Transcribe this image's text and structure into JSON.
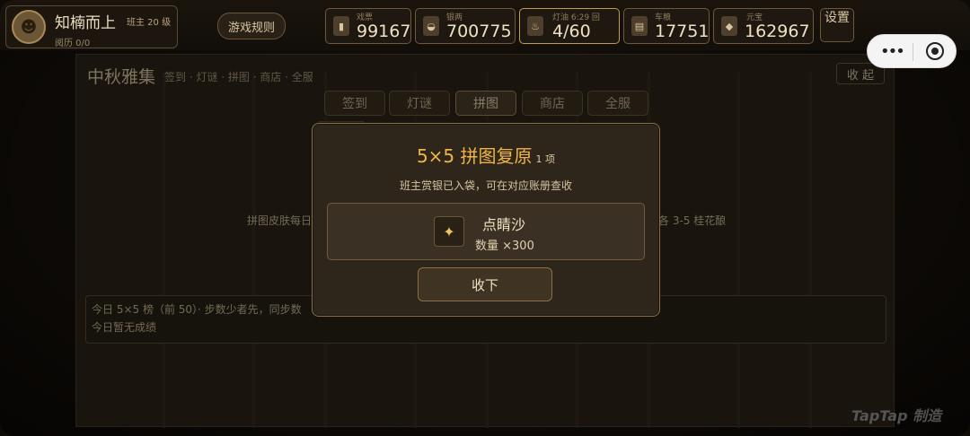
{
  "header": {
    "player_name": "知楠而上",
    "player_level": "班主 20 级",
    "player_sub": "阅历 0/0",
    "rules_label": "游戏规则",
    "settings_label": "设置",
    "resources": [
      {
        "label": "戏票",
        "value": "99167",
        "icon": "ticket-icon"
      },
      {
        "label": "银两",
        "value": "700775",
        "icon": "silver-icon"
      },
      {
        "label": "灯油 6:29 回",
        "value": "4/60",
        "icon": "oil-lamp-icon"
      },
      {
        "label": "车粮",
        "value": "17751",
        "icon": "grain-icon"
      },
      {
        "label": "元宝",
        "value": "162967",
        "icon": "ingot-icon"
      }
    ]
  },
  "panel": {
    "title": "中秋雅集",
    "subtitle": "签到 · 灯谜 · 拼图 · 商店 · 全服",
    "collapse_label": "收 起",
    "tabs": [
      {
        "label": "签到",
        "active": false
      },
      {
        "label": "灯谜",
        "active": false
      },
      {
        "label": "拼图",
        "active": true
      },
      {
        "label": "商店",
        "active": false
      },
      {
        "label": "全服",
        "active": false
      }
    ],
    "desc_left": "拼图皮肤每日",
    "desc_right": "各 3-5 桂花酿",
    "rank_line1": "今日 5×5 榜（前 50）· 步数少者先，同步数",
    "rank_line2": "今日暂无成绩"
  },
  "modal": {
    "title": "5×5 拼图复原",
    "count": "1 项",
    "desc": "班主赏银已入袋，可在对应账册查收",
    "reward_name": "点睛沙",
    "reward_qty": "数量 ×300",
    "accept_label": "收下"
  },
  "watermark": "TapTap 制造",
  "colors": {
    "accent": "#f0b449",
    "panel": "#2c2419",
    "border": "#8a7048"
  }
}
